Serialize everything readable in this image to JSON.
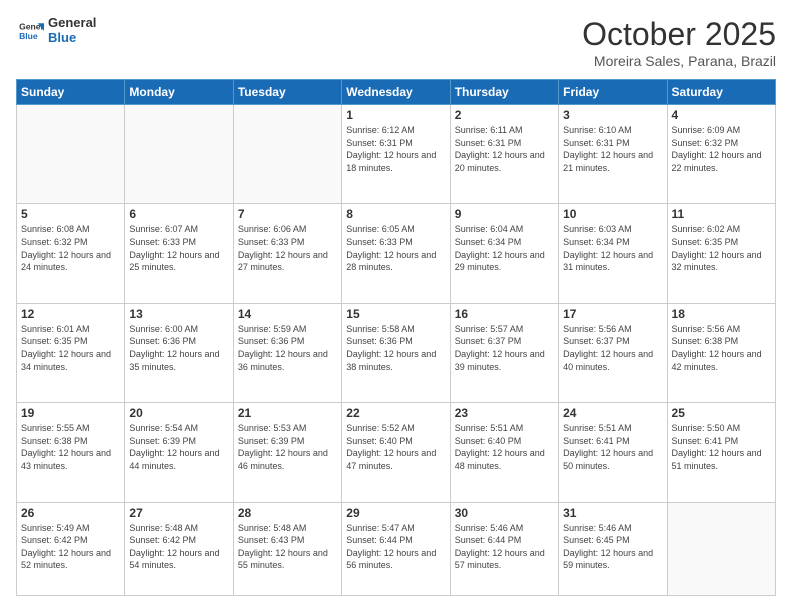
{
  "header": {
    "logo_general": "General",
    "logo_blue": "Blue",
    "month": "October 2025",
    "location": "Moreira Sales, Parana, Brazil"
  },
  "weekdays": [
    "Sunday",
    "Monday",
    "Tuesday",
    "Wednesday",
    "Thursday",
    "Friday",
    "Saturday"
  ],
  "weeks": [
    [
      {
        "day": "",
        "sunrise": "",
        "sunset": "",
        "daylight": ""
      },
      {
        "day": "",
        "sunrise": "",
        "sunset": "",
        "daylight": ""
      },
      {
        "day": "",
        "sunrise": "",
        "sunset": "",
        "daylight": ""
      },
      {
        "day": "1",
        "sunrise": "Sunrise: 6:12 AM",
        "sunset": "Sunset: 6:31 PM",
        "daylight": "Daylight: 12 hours and 18 minutes."
      },
      {
        "day": "2",
        "sunrise": "Sunrise: 6:11 AM",
        "sunset": "Sunset: 6:31 PM",
        "daylight": "Daylight: 12 hours and 20 minutes."
      },
      {
        "day": "3",
        "sunrise": "Sunrise: 6:10 AM",
        "sunset": "Sunset: 6:31 PM",
        "daylight": "Daylight: 12 hours and 21 minutes."
      },
      {
        "day": "4",
        "sunrise": "Sunrise: 6:09 AM",
        "sunset": "Sunset: 6:32 PM",
        "daylight": "Daylight: 12 hours and 22 minutes."
      }
    ],
    [
      {
        "day": "5",
        "sunrise": "Sunrise: 6:08 AM",
        "sunset": "Sunset: 6:32 PM",
        "daylight": "Daylight: 12 hours and 24 minutes."
      },
      {
        "day": "6",
        "sunrise": "Sunrise: 6:07 AM",
        "sunset": "Sunset: 6:33 PM",
        "daylight": "Daylight: 12 hours and 25 minutes."
      },
      {
        "day": "7",
        "sunrise": "Sunrise: 6:06 AM",
        "sunset": "Sunset: 6:33 PM",
        "daylight": "Daylight: 12 hours and 27 minutes."
      },
      {
        "day": "8",
        "sunrise": "Sunrise: 6:05 AM",
        "sunset": "Sunset: 6:33 PM",
        "daylight": "Daylight: 12 hours and 28 minutes."
      },
      {
        "day": "9",
        "sunrise": "Sunrise: 6:04 AM",
        "sunset": "Sunset: 6:34 PM",
        "daylight": "Daylight: 12 hours and 29 minutes."
      },
      {
        "day": "10",
        "sunrise": "Sunrise: 6:03 AM",
        "sunset": "Sunset: 6:34 PM",
        "daylight": "Daylight: 12 hours and 31 minutes."
      },
      {
        "day": "11",
        "sunrise": "Sunrise: 6:02 AM",
        "sunset": "Sunset: 6:35 PM",
        "daylight": "Daylight: 12 hours and 32 minutes."
      }
    ],
    [
      {
        "day": "12",
        "sunrise": "Sunrise: 6:01 AM",
        "sunset": "Sunset: 6:35 PM",
        "daylight": "Daylight: 12 hours and 34 minutes."
      },
      {
        "day": "13",
        "sunrise": "Sunrise: 6:00 AM",
        "sunset": "Sunset: 6:36 PM",
        "daylight": "Daylight: 12 hours and 35 minutes."
      },
      {
        "day": "14",
        "sunrise": "Sunrise: 5:59 AM",
        "sunset": "Sunset: 6:36 PM",
        "daylight": "Daylight: 12 hours and 36 minutes."
      },
      {
        "day": "15",
        "sunrise": "Sunrise: 5:58 AM",
        "sunset": "Sunset: 6:36 PM",
        "daylight": "Daylight: 12 hours and 38 minutes."
      },
      {
        "day": "16",
        "sunrise": "Sunrise: 5:57 AM",
        "sunset": "Sunset: 6:37 PM",
        "daylight": "Daylight: 12 hours and 39 minutes."
      },
      {
        "day": "17",
        "sunrise": "Sunrise: 5:56 AM",
        "sunset": "Sunset: 6:37 PM",
        "daylight": "Daylight: 12 hours and 40 minutes."
      },
      {
        "day": "18",
        "sunrise": "Sunrise: 5:56 AM",
        "sunset": "Sunset: 6:38 PM",
        "daylight": "Daylight: 12 hours and 42 minutes."
      }
    ],
    [
      {
        "day": "19",
        "sunrise": "Sunrise: 5:55 AM",
        "sunset": "Sunset: 6:38 PM",
        "daylight": "Daylight: 12 hours and 43 minutes."
      },
      {
        "day": "20",
        "sunrise": "Sunrise: 5:54 AM",
        "sunset": "Sunset: 6:39 PM",
        "daylight": "Daylight: 12 hours and 44 minutes."
      },
      {
        "day": "21",
        "sunrise": "Sunrise: 5:53 AM",
        "sunset": "Sunset: 6:39 PM",
        "daylight": "Daylight: 12 hours and 46 minutes."
      },
      {
        "day": "22",
        "sunrise": "Sunrise: 5:52 AM",
        "sunset": "Sunset: 6:40 PM",
        "daylight": "Daylight: 12 hours and 47 minutes."
      },
      {
        "day": "23",
        "sunrise": "Sunrise: 5:51 AM",
        "sunset": "Sunset: 6:40 PM",
        "daylight": "Daylight: 12 hours and 48 minutes."
      },
      {
        "day": "24",
        "sunrise": "Sunrise: 5:51 AM",
        "sunset": "Sunset: 6:41 PM",
        "daylight": "Daylight: 12 hours and 50 minutes."
      },
      {
        "day": "25",
        "sunrise": "Sunrise: 5:50 AM",
        "sunset": "Sunset: 6:41 PM",
        "daylight": "Daylight: 12 hours and 51 minutes."
      }
    ],
    [
      {
        "day": "26",
        "sunrise": "Sunrise: 5:49 AM",
        "sunset": "Sunset: 6:42 PM",
        "daylight": "Daylight: 12 hours and 52 minutes."
      },
      {
        "day": "27",
        "sunrise": "Sunrise: 5:48 AM",
        "sunset": "Sunset: 6:42 PM",
        "daylight": "Daylight: 12 hours and 54 minutes."
      },
      {
        "day": "28",
        "sunrise": "Sunrise: 5:48 AM",
        "sunset": "Sunset: 6:43 PM",
        "daylight": "Daylight: 12 hours and 55 minutes."
      },
      {
        "day": "29",
        "sunrise": "Sunrise: 5:47 AM",
        "sunset": "Sunset: 6:44 PM",
        "daylight": "Daylight: 12 hours and 56 minutes."
      },
      {
        "day": "30",
        "sunrise": "Sunrise: 5:46 AM",
        "sunset": "Sunset: 6:44 PM",
        "daylight": "Daylight: 12 hours and 57 minutes."
      },
      {
        "day": "31",
        "sunrise": "Sunrise: 5:46 AM",
        "sunset": "Sunset: 6:45 PM",
        "daylight": "Daylight: 12 hours and 59 minutes."
      },
      {
        "day": "",
        "sunrise": "",
        "sunset": "",
        "daylight": ""
      }
    ]
  ]
}
